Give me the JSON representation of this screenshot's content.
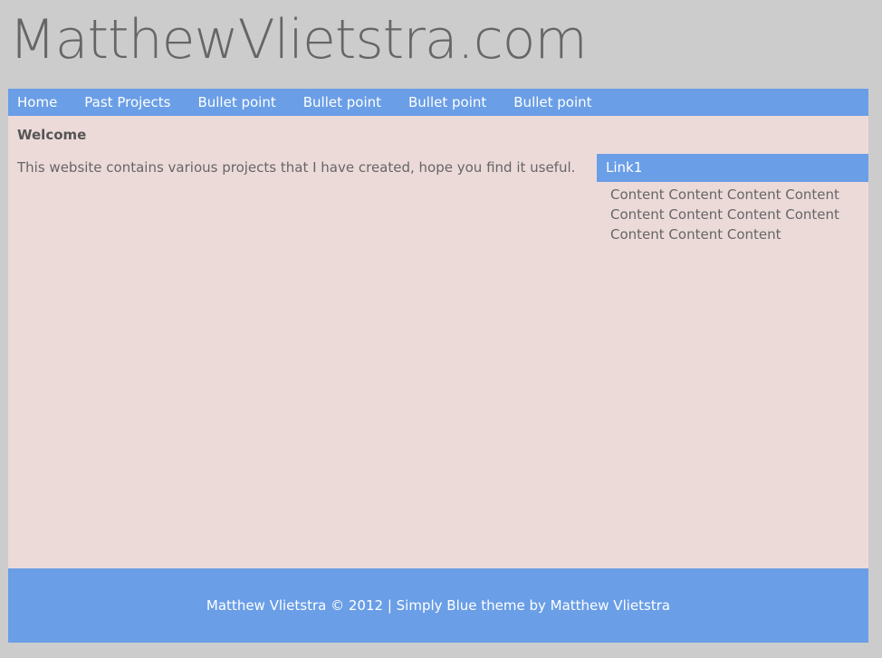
{
  "site": {
    "title": "MatthewVlietstra.com"
  },
  "nav": {
    "items": [
      {
        "label": "Home"
      },
      {
        "label": "Past Projects"
      },
      {
        "label": "Bullet point"
      },
      {
        "label": "Bullet point"
      },
      {
        "label": "Bullet point"
      },
      {
        "label": "Bullet point"
      }
    ]
  },
  "main": {
    "heading": "Welcome",
    "intro": "This website contains various projects that I have created, hope you find it useful."
  },
  "sidebar": {
    "link_label": "Link1",
    "content": "Content Content Content Content Content Content Content Content Content Content Content"
  },
  "footer": {
    "text": "Matthew Vlietstra © 2012 | Simply Blue theme by Matthew Vlietstra"
  },
  "colors": {
    "background": "#cccccc",
    "accent": "#6a9ee6",
    "content_bg": "#ecdad9",
    "title_text": "#666666"
  }
}
